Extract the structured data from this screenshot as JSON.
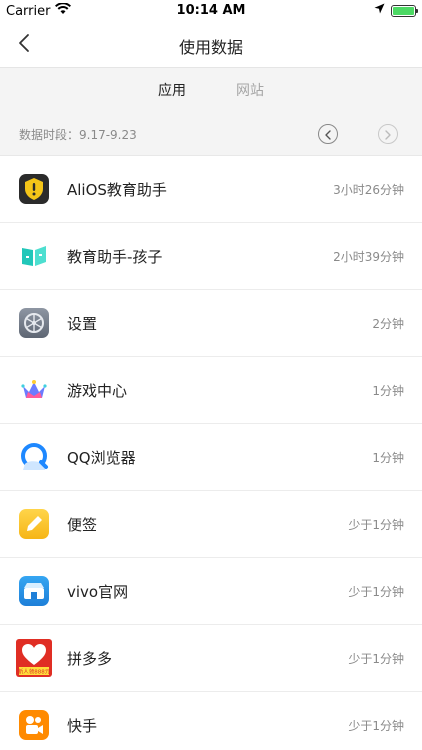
{
  "status": {
    "carrier": "Carrier",
    "time": "10:14 AM"
  },
  "nav": {
    "title": "使用数据"
  },
  "tabs": [
    {
      "label": "应用",
      "active": true
    },
    {
      "label": "网站",
      "active": false
    }
  ],
  "period": {
    "label": "数据时段：9.17-9.23"
  },
  "apps": [
    {
      "name": "AliOS教育助手",
      "time": "3小时26分钟",
      "icon": "alios-shield-icon"
    },
    {
      "name": "教育助手-孩子",
      "time": "2小时39分钟",
      "icon": "edu-book-icon"
    },
    {
      "name": "设置",
      "time": "2分钟",
      "icon": "settings-gear-icon"
    },
    {
      "name": "游戏中心",
      "time": "1分钟",
      "icon": "game-crown-icon"
    },
    {
      "name": "QQ浏览器",
      "time": "1分钟",
      "icon": "qq-browser-icon"
    },
    {
      "name": "便签",
      "time": "少于1分钟",
      "icon": "notes-pen-icon"
    },
    {
      "name": "vivo官网",
      "time": "少于1分钟",
      "icon": "vivo-store-icon"
    },
    {
      "name": "拼多多",
      "time": "少于1分钟",
      "icon": "pinduoduo-icon"
    },
    {
      "name": "快手",
      "time": "少于1分钟",
      "icon": "kuaishou-camera-icon"
    }
  ],
  "pdd_icon_caption": "新人领888元",
  "colors": {
    "battery": "#4cd964",
    "tab_active": "#222222",
    "tab_inactive": "#a6a6a6",
    "secondary_text": "#8a8a8a"
  }
}
